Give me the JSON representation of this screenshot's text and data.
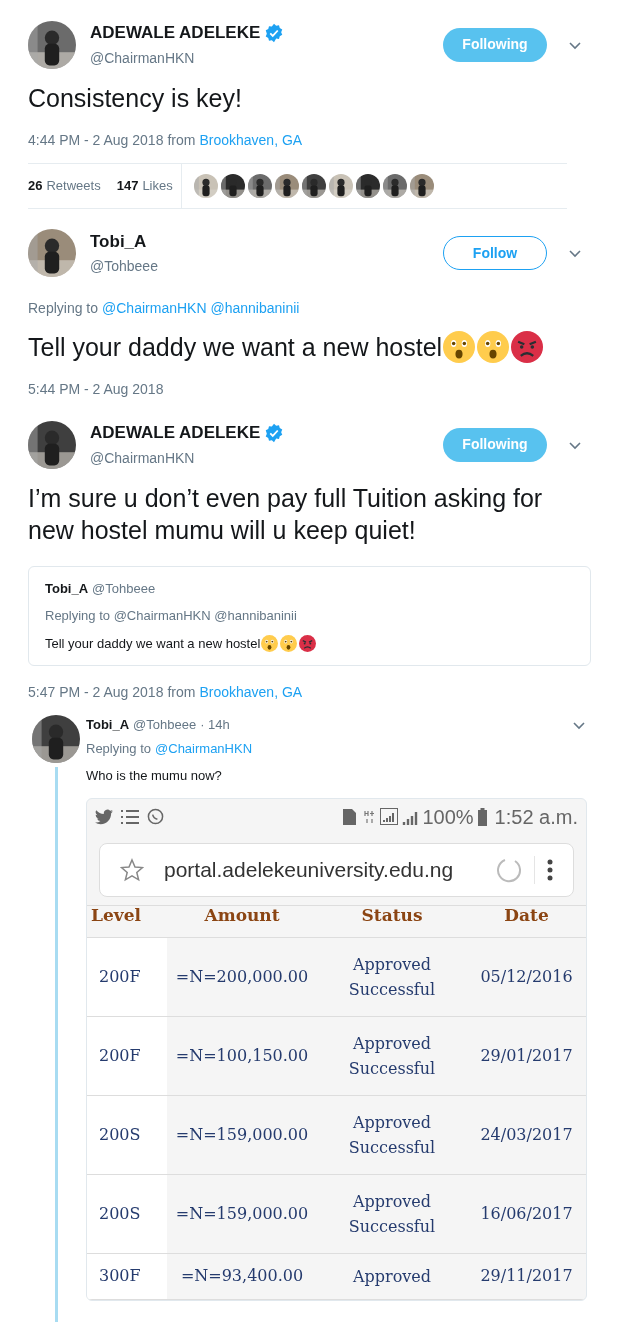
{
  "tweets": [
    {
      "kind": "main",
      "name": "ADEWALE ADELEKE",
      "verified": true,
      "handle": "@ChairmanHKN",
      "follow": {
        "label": "Following",
        "selected": true
      },
      "text": "Consistency is key!",
      "time": "4:44 PM - 2 Aug 2018",
      "from": "from",
      "place": "Brookhaven, GA",
      "stats": {
        "retweets": "26",
        "retweets_label": "Retweets",
        "likes": "147",
        "likes_label": "Likes"
      }
    },
    {
      "kind": "main",
      "name": "Tobi_A",
      "verified": false,
      "handle": "@Tohbeee",
      "follow": {
        "label": "Follow",
        "selected": false
      },
      "replying": "Replying to",
      "mentions": [
        "@ChairmanHKN",
        "@hannibaninii"
      ],
      "text": "Tell your daddy we want a new hostel",
      "emoji": [
        {
          "kind": "astonished"
        },
        {
          "kind": "astonished"
        },
        {
          "kind": "angry"
        }
      ],
      "time": "5:44 PM - 2 Aug 2018"
    },
    {
      "kind": "main",
      "name": "ADEWALE ADELEKE",
      "verified": true,
      "handle": "@ChairmanHKN",
      "follow": {
        "label": "Following",
        "selected": true
      },
      "text": "I’m sure u don’t even pay full Tuition asking for new hostel mumu will u keep quiet!",
      "quote": {
        "name": "Tobi_A",
        "handle": "@Tohbeee",
        "replying": "Replying to @ChairmanHKN @hannibaninii",
        "text": "Tell your daddy we want a new hostel",
        "emoji": [
          {
            "kind": "astonished"
          },
          {
            "kind": "astonished"
          },
          {
            "kind": "angry"
          }
        ]
      },
      "time": "5:47 PM - 2 Aug 2018",
      "from": "from",
      "place": "Brookhaven, GA"
    },
    {
      "kind": "reply",
      "name": "Tobi_A",
      "handle": "@Tohbeee",
      "age": "· 14h",
      "replying": "Replying to",
      "mentions": [
        "@ChairmanHKN"
      ],
      "text": "Who is the mumu now?",
      "phone": {
        "battery": "100%",
        "clock": "1:52 a.m.",
        "url": "portal.adelekeuniversity.edu.ng",
        "columns": [
          "Level",
          "Amount",
          "Status",
          "Date"
        ],
        "rows": [
          [
            "200F",
            "=N=200,000.00",
            "Approved Successful",
            "05/12/2016"
          ],
          [
            "200F",
            "=N=100,150.00",
            "Approved Successful",
            "29/01/2017"
          ],
          [
            "200S",
            "=N=159,000.00",
            "Approved Successful",
            "24/03/2017"
          ],
          [
            "200S",
            "=N=159,000.00",
            "Approved Successful",
            "16/06/2017"
          ],
          [
            "300F",
            "=N=93,400.00",
            "Approved",
            "29/11/2017"
          ]
        ]
      }
    }
  ]
}
